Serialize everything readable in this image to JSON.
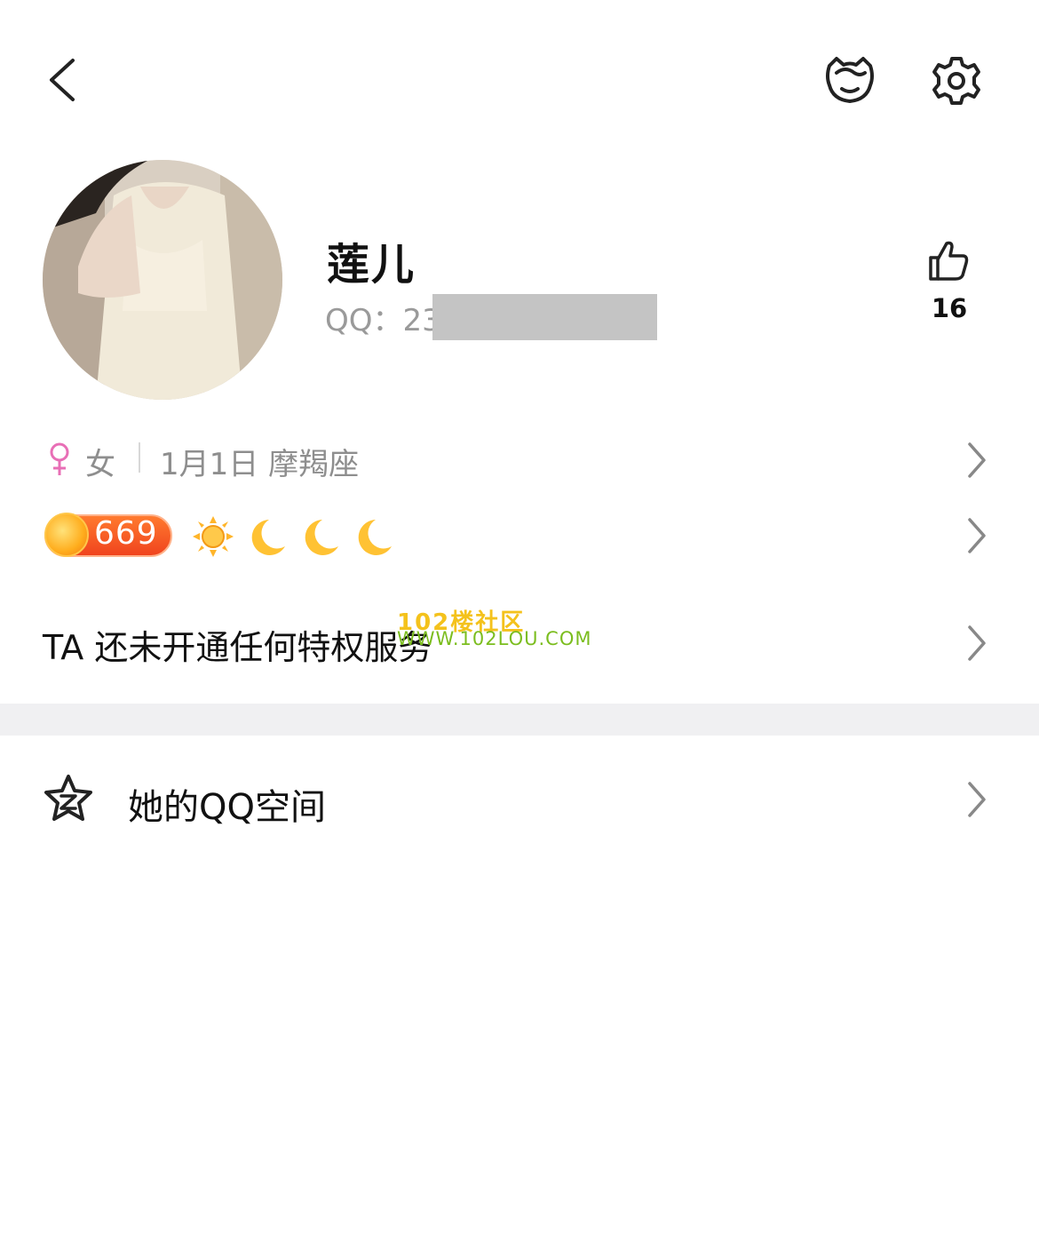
{
  "header": {
    "back_icon": "chevron-left-icon",
    "friend_icon": "cat-face-icon",
    "settings_icon": "gear-icon"
  },
  "profile": {
    "nickname": "莲儿",
    "qq_prefix": "QQ：23",
    "likes_icon": "thumbs-up-icon",
    "likes_count": "16"
  },
  "info": {
    "gender_symbol": "♀",
    "gender": "女",
    "birthday_zodiac": "1月1日 摩羯座",
    "gender_color": "#e86fb6"
  },
  "level": {
    "badge_value": "669",
    "icons": [
      "sun-icon",
      "moon-icon",
      "moon-icon",
      "moon-icon"
    ],
    "badge_color": "#f0441e"
  },
  "privilege": {
    "text": "TA 还未开通任何特权服务"
  },
  "watermark": {
    "line1": "102楼社区",
    "line2": "WWW.102LOU.COM"
  },
  "qzone": {
    "icon": "qzone-star-icon",
    "label": "她的QQ空间"
  }
}
